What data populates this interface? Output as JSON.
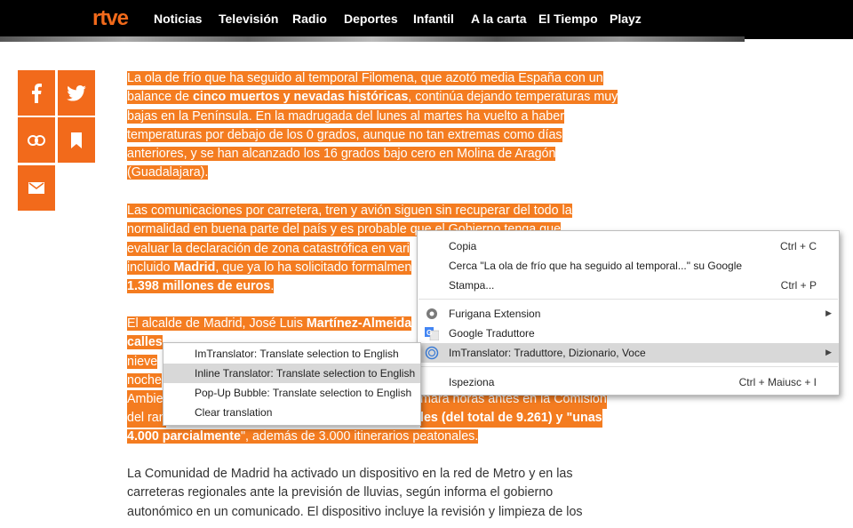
{
  "header": {
    "logo": "rtve",
    "nav": [
      "Noticias",
      "Televisión",
      "Radio",
      "Deportes",
      "Infantil",
      "A la carta",
      "El Tiempo",
      "Playz"
    ]
  },
  "share_icons": [
    "facebook-icon",
    "twitter-icon",
    "link-icon",
    "bookmark-icon",
    "email-icon"
  ],
  "article": {
    "p1": {
      "a": "La ola de frío que ha seguido al temporal Filomena, que azotó media España con un balance de ",
      "b": "cinco muertos y nevadas históricas",
      "c": ", continúa dejando temperaturas muy bajas en la Península. En la madrugada del lunes al martes ha vuelto a haber temperaturas por debajo de los 0 grados, aunque no tan extremas como días anteriores, y se han alcanzado los 16 grados bajo cero en Molina de Aragón (Guadalajara)."
    },
    "p2": {
      "l1": "Las comunicaciones por carretera, tren y avión siguen sin recuperar del todo la",
      "l2": "normalidad en buena parte del país y es probable que el Gobierno tenga que",
      "l3": "evaluar la declaración de zona catastrófica en vari",
      "l4a": "incluido ",
      "l4b": "Madrid",
      "l4c": ", que ya lo ha solicitado formalmen",
      "l5": "1.398 millones de euros",
      "l5end": "."
    },
    "p3": {
      "l1a": "El alcalde de Madrid, José Luis ",
      "l1b": "Martínez-Almeida",
      "l2": "calles",
      "l3": "nieve",
      "l4": "noche",
      "l5a": "Ambie",
      "l5b": "mara horas antes en la Comisión",
      "l6a": "del ran",
      "l6b": "les (del total de 9.261) y \"unas",
      "l7a": "4.000 parcialmente",
      "l7b": "\", además de 3.000 itinerarios peatonales."
    },
    "p4": {
      "l1": "La Comunidad de Madrid ha activado un dispositivo en la red de Metro y en las",
      "l2": "carreteras regionales ante la previsión de lluvias, según informa el gobierno",
      "l3": "autonómico en un comunicado. El dispositivo  incluye la revisión y limpieza de los"
    }
  },
  "context_menu": {
    "copy": {
      "label": "Copia",
      "shortcut": "Ctrl + C"
    },
    "search": {
      "label": "Cerca \"La ola de frío que ha seguido al temporal...\" su Google"
    },
    "print": {
      "label": "Stampa...",
      "shortcut": "Ctrl + P"
    },
    "furigana": {
      "label": "Furigana Extension",
      "icon": "furigana-icon"
    },
    "google_translate": {
      "label": "Google Traduttore",
      "icon": "google-translate-icon"
    },
    "imtranslator": {
      "label": "ImTranslator: Traduttore, Dizionario, Voce",
      "icon": "imtranslator-icon"
    },
    "inspect": {
      "label": "Ispeziona",
      "shortcut": "Ctrl + Maiusc + I"
    }
  },
  "submenu": {
    "items": [
      "ImTranslator: Translate selection to English",
      "Inline Translator: Translate selection to English",
      "Pop-Up Bubble: Translate selection to English",
      "Clear translation"
    ]
  },
  "colors": {
    "accent": "#f26a1b",
    "selection": "#f47c20",
    "nav_bg": "#000000"
  }
}
